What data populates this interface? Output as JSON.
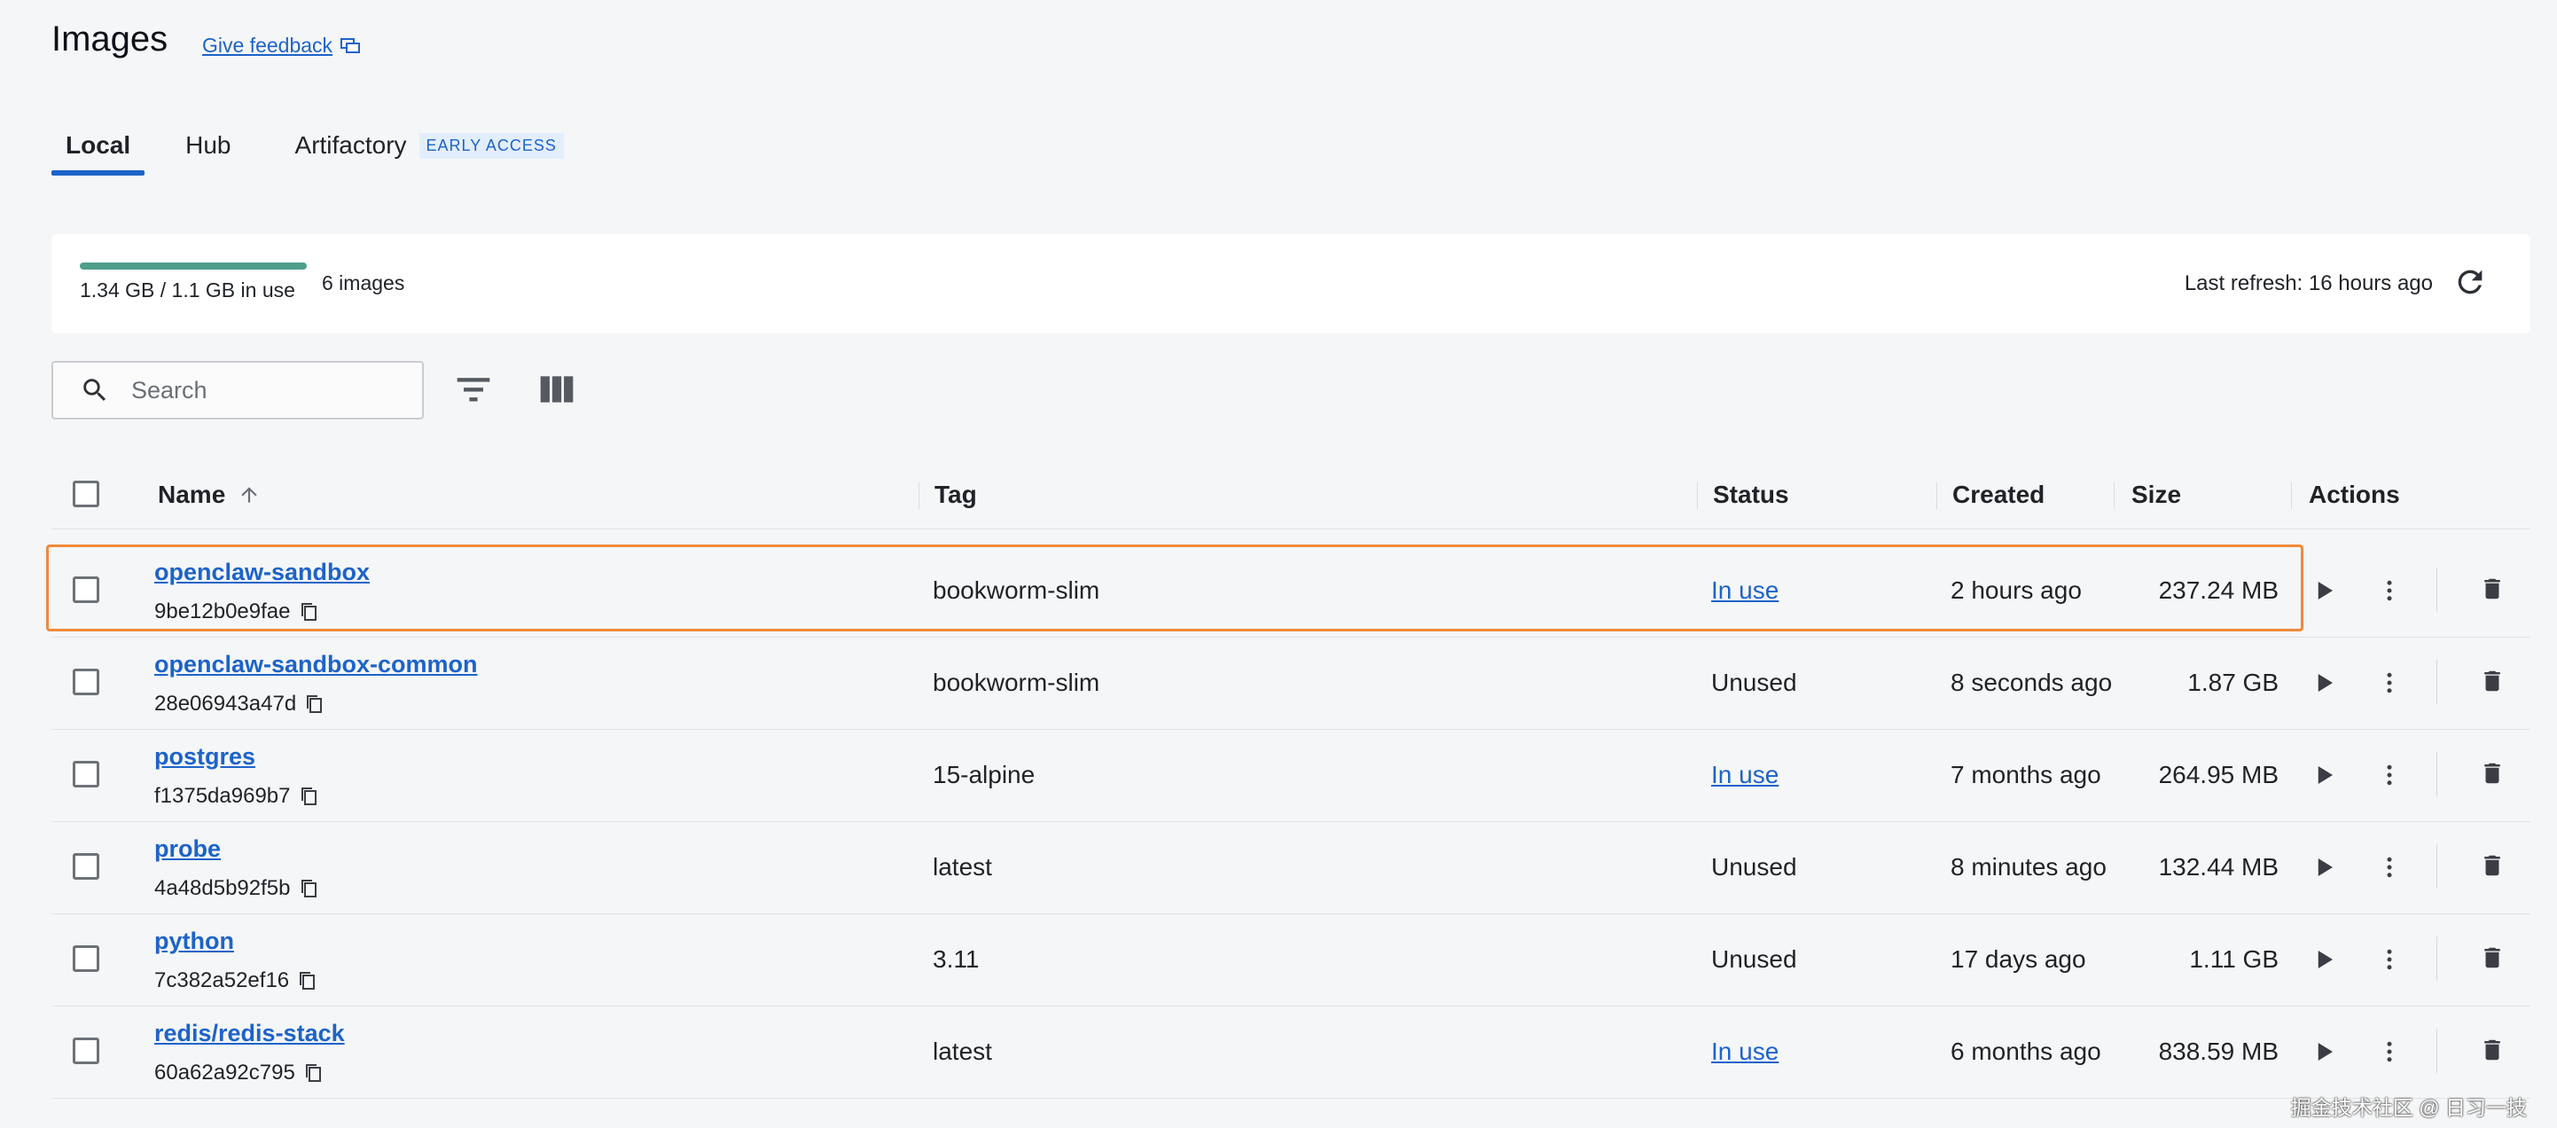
{
  "page": {
    "title": "Images",
    "feedback_label": "Give feedback"
  },
  "tabs": [
    {
      "label": "Local",
      "active": true
    },
    {
      "label": "Hub",
      "active": false
    },
    {
      "label": "Artifactory",
      "active": false,
      "badge": "EARLY ACCESS"
    }
  ],
  "usage": {
    "text": "1.34 GB / 1.1 GB in use",
    "count": "6 images",
    "last_refresh": "Last refresh: 16 hours ago",
    "fill_fraction": 1.0
  },
  "search": {
    "placeholder": "Search",
    "value": ""
  },
  "table": {
    "headers": {
      "name": "Name",
      "tag": "Tag",
      "status": "Status",
      "created": "Created",
      "size": "Size",
      "actions": "Actions"
    },
    "sort_column": "Name",
    "sort_direction": "ascending",
    "rows": [
      {
        "name": "openclaw-sandbox",
        "id": "9be12b0e9fae",
        "tag": "bookworm-slim",
        "status": "In use",
        "created": "2 hours ago",
        "size": "237.24 MB"
      },
      {
        "name": "openclaw-sandbox-common",
        "id": "28e06943a47d",
        "tag": "bookworm-slim",
        "status": "Unused",
        "created": "8 seconds ago",
        "size": "1.87 GB"
      },
      {
        "name": "postgres",
        "id": "f1375da969b7",
        "tag": "15-alpine",
        "status": "In use",
        "created": "7 months ago",
        "size": "264.95 MB"
      },
      {
        "name": "probe",
        "id": "4a48d5b92f5b",
        "tag": "latest",
        "status": "Unused",
        "created": "8 minutes ago",
        "size": "132.44 MB"
      },
      {
        "name": "python",
        "id": "7c382a52ef16",
        "tag": "3.11",
        "status": "Unused",
        "created": "17 days ago",
        "size": "1.11 GB"
      },
      {
        "name": "redis/redis-stack",
        "id": "60a62a92c795",
        "tag": "latest",
        "status": "In use",
        "created": "6 months ago",
        "size": "838.59 MB"
      }
    ]
  },
  "watermark": "掘金技术社区 @ 日习一技",
  "colors": {
    "accent": "#1d63c9",
    "usage_bar": "#4f9e8c",
    "highlight": "#ef8a3a",
    "background": "#f5f6f7"
  }
}
